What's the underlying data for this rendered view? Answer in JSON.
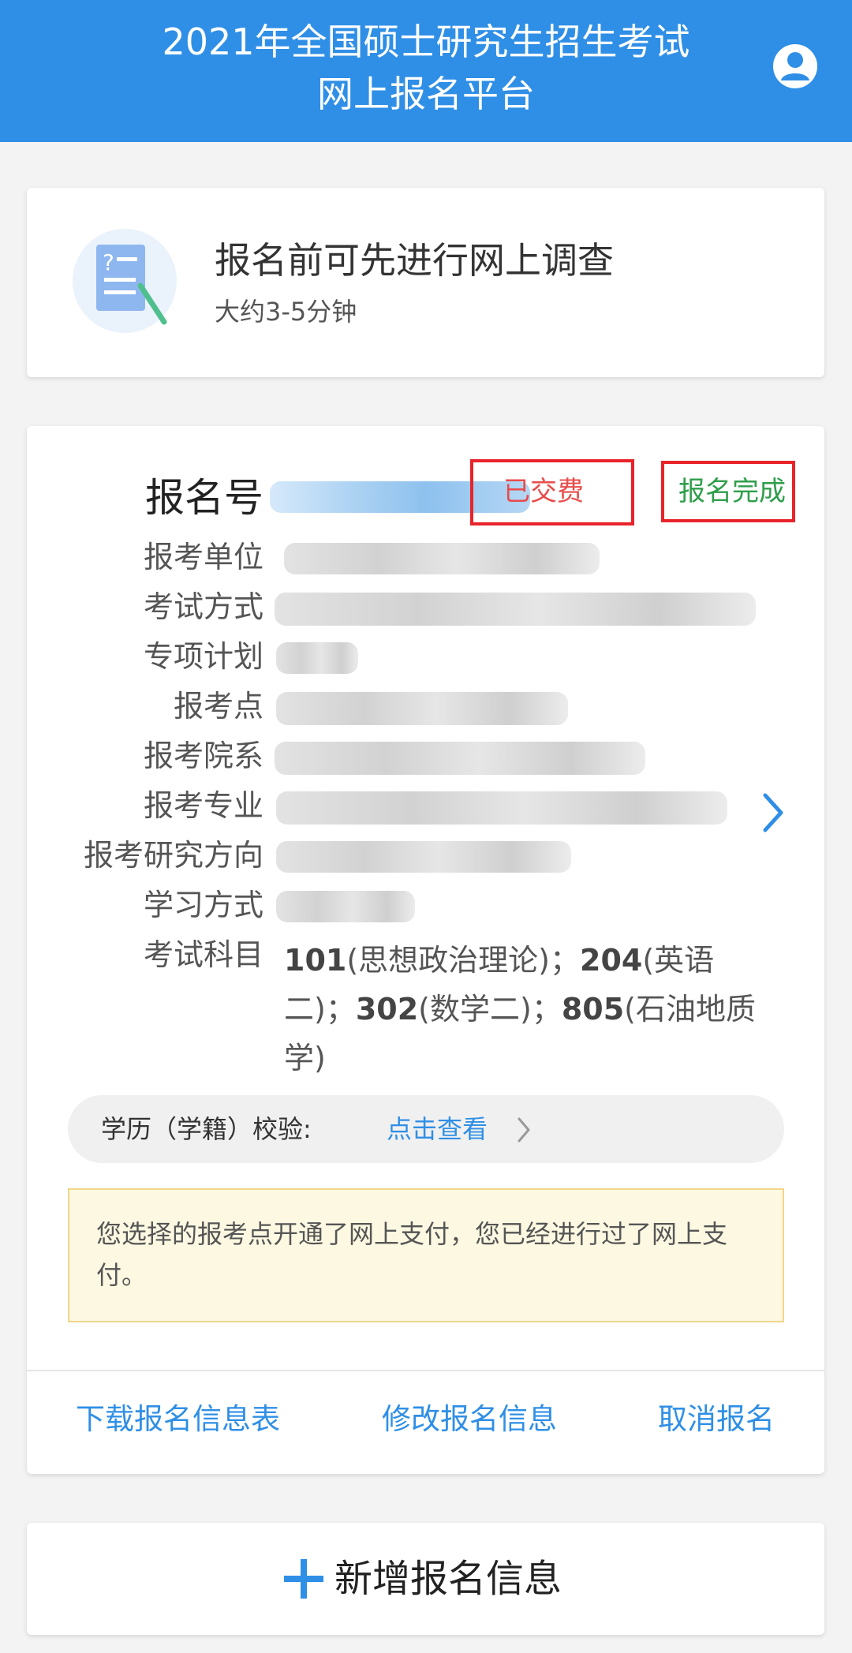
{
  "header": {
    "title_line1": "2021年全国硕士研究生招生考试",
    "title_line2": "网上报名平台",
    "avatar_icon": "user-avatar-icon"
  },
  "survey": {
    "title": "报名前可先进行网上调查",
    "subtitle": "大约3-5分钟",
    "icon": "survey-document-icon"
  },
  "registration": {
    "number_label": "报名号",
    "payment_status": "已交费",
    "registration_status": "报名完成",
    "fields": [
      {
        "label": "报考单位"
      },
      {
        "label": "考试方式"
      },
      {
        "label": "专项计划"
      },
      {
        "label": "报考点"
      },
      {
        "label": "报考院系"
      },
      {
        "label": "报考专业"
      },
      {
        "label": "报考研究方向"
      },
      {
        "label": "学习方式"
      }
    ],
    "subjects_label": "考试科目",
    "subjects": [
      {
        "code": "101",
        "name": "(思想政治理论)"
      },
      {
        "code": "204",
        "name": "(英语二)"
      },
      {
        "code": "302",
        "name": "(数学二)"
      },
      {
        "code": "805",
        "name": "(石油地质学)"
      }
    ],
    "subject_separator": "；",
    "verify_label": "学历（学籍）校验:",
    "verify_link": "点击查看",
    "notice": "您选择的报考点开通了网上支付，您已经进行过了网上支付。",
    "actions": {
      "download": "下载报名信息表",
      "edit": "修改报名信息",
      "cancel": "取消报名"
    }
  },
  "add": {
    "label": "新增报名信息",
    "icon": "plus-icon"
  },
  "colors": {
    "primary": "#2f8fe6",
    "paid_red": "#e84b4b",
    "done_green": "#2f9e4b",
    "highlight_border": "#e8232a",
    "notice_bg": "#fcf8e2"
  }
}
